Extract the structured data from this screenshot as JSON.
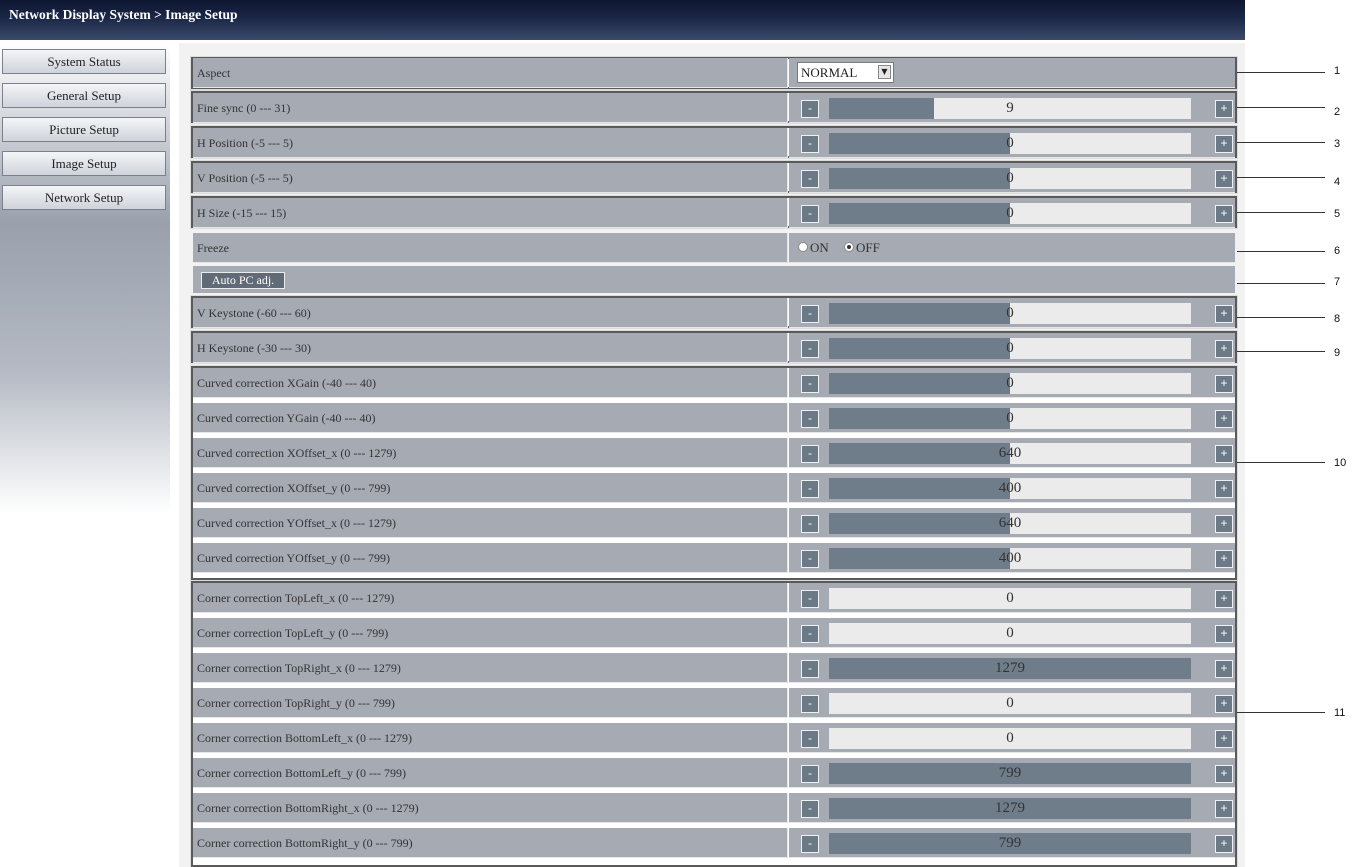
{
  "title": "Network Display System > Image Setup",
  "nav": [
    {
      "label": "System Status"
    },
    {
      "label": "General Setup"
    },
    {
      "label": "Picture Setup"
    },
    {
      "label": "Image Setup"
    },
    {
      "label": "Network Setup"
    }
  ],
  "aspect": {
    "label": "Aspect",
    "value": "NORMAL"
  },
  "freeze": {
    "label": "Freeze",
    "on": "ON",
    "off": "OFF",
    "selected": "OFF"
  },
  "auto_pc_label": "Auto PC adj.",
  "controls": {
    "minus_label": "-",
    "plus_label": "+"
  },
  "rows": {
    "fine_sync": {
      "label": "Fine sync (0 --- 31)",
      "value": "9",
      "fill": 0.29
    },
    "h_position": {
      "label": "H Position (-5 --- 5)",
      "value": "0",
      "fill": 0.5
    },
    "v_position": {
      "label": "V Position (-5 --- 5)",
      "value": "0",
      "fill": 0.5
    },
    "h_size": {
      "label": "H Size (-15 --- 15)",
      "value": "0",
      "fill": 0.5
    },
    "v_keystone": {
      "label": "V Keystone (-60 --- 60)",
      "value": "0",
      "fill": 0.5
    },
    "h_keystone": {
      "label": "H Keystone (-30 --- 30)",
      "value": "0",
      "fill": 0.5
    },
    "curved_xgain": {
      "label": "Curved correction XGain (-40 --- 40)",
      "value": "0",
      "fill": 0.5
    },
    "curved_ygain": {
      "label": "Curved correction YGain (-40 --- 40)",
      "value": "0",
      "fill": 0.5
    },
    "curved_xoffset_x": {
      "label": "Curved correction XOffset_x (0 --- 1279)",
      "value": "640",
      "fill": 0.5
    },
    "curved_xoffset_y": {
      "label": "Curved correction XOffset_y (0 --- 799)",
      "value": "400",
      "fill": 0.5
    },
    "curved_yoffset_x": {
      "label": "Curved correction YOffset_x (0 --- 1279)",
      "value": "640",
      "fill": 0.5
    },
    "curved_yoffset_y": {
      "label": "Curved correction YOffset_y (0 --- 799)",
      "value": "400",
      "fill": 0.5
    },
    "corner_topleft_x": {
      "label": "Corner correction TopLeft_x (0 --- 1279)",
      "value": "0",
      "fill": 0
    },
    "corner_topleft_y": {
      "label": "Corner correction TopLeft_y (0 --- 799)",
      "value": "0",
      "fill": 0
    },
    "corner_topright_x": {
      "label": "Corner correction TopRight_x (0 --- 1279)",
      "value": "1279",
      "fill": 1
    },
    "corner_topright_y": {
      "label": "Corner correction TopRight_y (0 --- 799)",
      "value": "0",
      "fill": 0
    },
    "corner_bottomleft_x": {
      "label": "Corner correction BottomLeft_x (0 --- 1279)",
      "value": "0",
      "fill": 0
    },
    "corner_bottomleft_y": {
      "label": "Corner correction BottomLeft_y (0 --- 799)",
      "value": "799",
      "fill": 1
    },
    "corner_bottomright_x": {
      "label": "Corner correction BottomRight_x (0 --- 1279)",
      "value": "1279",
      "fill": 1
    },
    "corner_bottomright_y": {
      "label": "Corner correction BottomRight_y (0 --- 799)",
      "value": "799",
      "fill": 1
    }
  },
  "callouts": [
    "1",
    "2",
    "3",
    "4",
    "5",
    "6",
    "7",
    "8",
    "9",
    "10",
    "11"
  ]
}
